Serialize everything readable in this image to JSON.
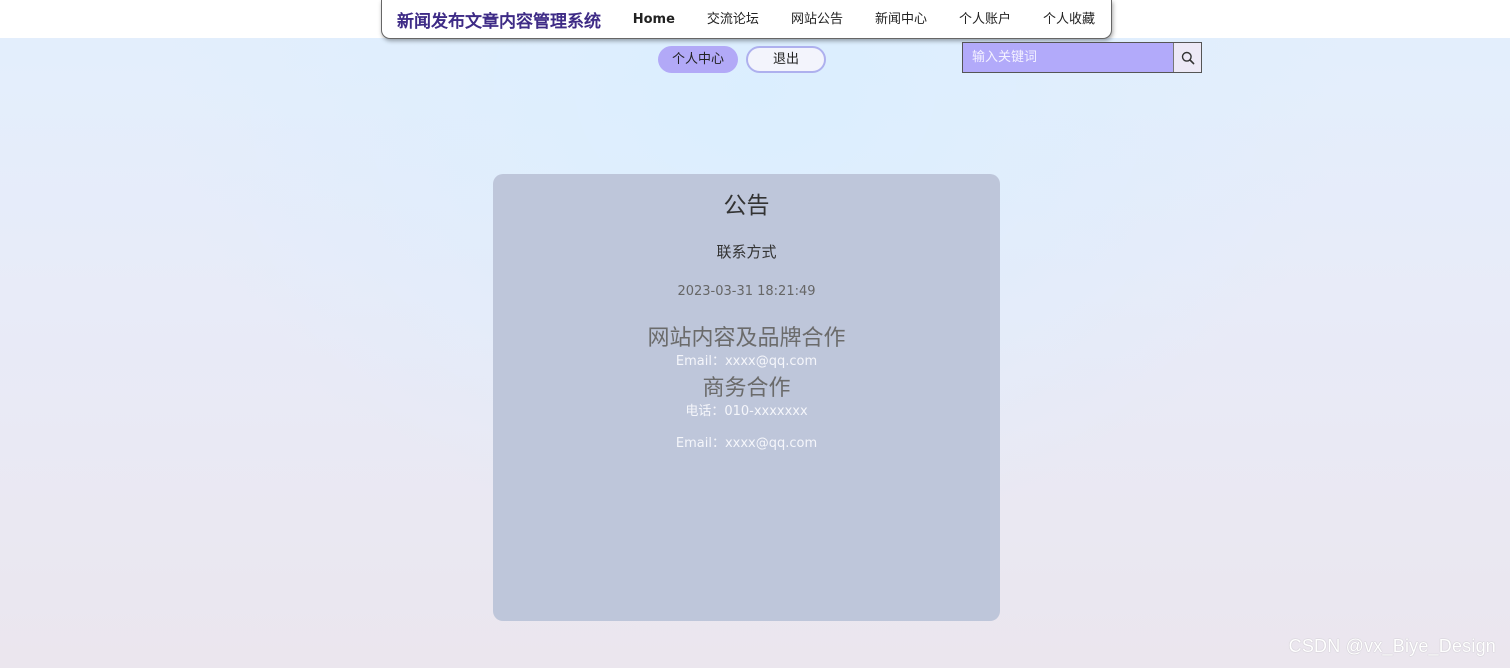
{
  "header": {
    "brand": "新闻发布文章内容管理系统",
    "nav": [
      "Home",
      "交流论坛",
      "网站公告",
      "新闻中心",
      "个人账户",
      "个人收藏"
    ]
  },
  "user_actions": {
    "profile_label": "个人中心",
    "logout_label": "退出"
  },
  "search": {
    "placeholder": "输入关键词",
    "icon": "search-icon"
  },
  "notice_card": {
    "heading": "公告",
    "title": "联系方式",
    "date": "2023-03-31 18:21:49",
    "sections": [
      {
        "heading": "网站内容及品牌合作",
        "lines": [
          "Email：xxxx@qq.com"
        ]
      },
      {
        "heading": "商务合作",
        "lines": [
          "电话：010-xxxxxxx",
          "Email：xxxx@qq.com"
        ]
      }
    ]
  },
  "watermark": "CSDN @vx_Biye_Design",
  "colors": {
    "brand": "#3e2b86",
    "accent": "#b2a9f7",
    "card": "#bec6da"
  }
}
